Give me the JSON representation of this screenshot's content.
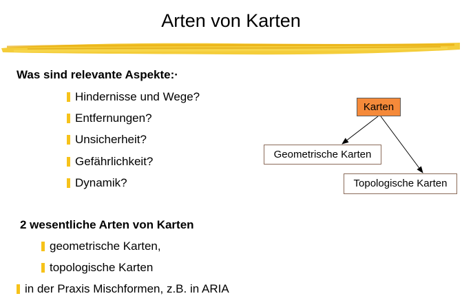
{
  "title": "Arten von Karten",
  "section1": {
    "heading": "Was sind relevante Aspekte:·",
    "items": [
      "Hindernisse und Wege?",
      "Entfernungen?",
      "Unsicherheit?",
      "Gefährlichkeit?",
      "Dynamik?"
    ]
  },
  "section2": {
    "heading": "2 wesentliche Arten von Karten",
    "items": [
      "geometrische Karten,",
      "topologische Karten"
    ]
  },
  "footer_item": "in der Praxis Mischformen, z.B. in ARIA",
  "diagram": {
    "root": "Karten",
    "children": [
      "Geometrische Karten",
      "Topologische Karten"
    ]
  },
  "colors": {
    "bullet": "#f6c21a",
    "brush": "#f2c418",
    "root_box": "#f58a3a"
  }
}
